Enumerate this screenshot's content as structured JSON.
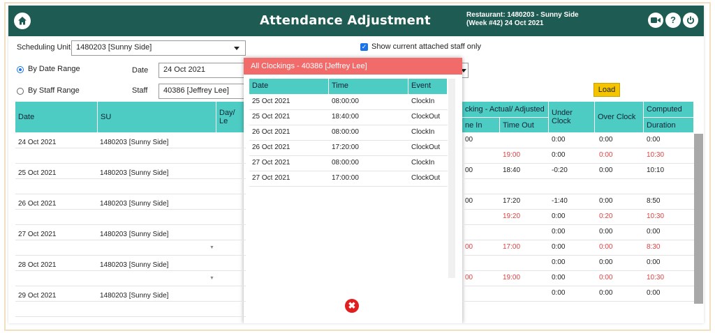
{
  "header": {
    "title": "Attendance Adjustment",
    "restaurant_line1": "Restaurant: 1480203  -  Sunny Side",
    "restaurant_line2": "(Week #42)  24 Oct 2021",
    "icons": [
      "home-icon",
      "video-icon",
      "help-icon",
      "power-icon"
    ],
    "help_glyph": "?",
    "accent": "#1e5b52"
  },
  "filters": {
    "scheduling_unit_label": "Scheduling Unit",
    "scheduling_unit_value": "1480203 [Sunny Side]",
    "show_current_label": "Show current attached staff only",
    "by_date_range_label": "By Date Range",
    "by_staff_range_label": "By Staff Range",
    "date_label": "Date",
    "date_value": "24 Oct 2021",
    "staff_label": "Staff",
    "staff_value": "40386 [Jeffrey Lee]",
    "load_label": "Load"
  },
  "grid": {
    "headers": {
      "date": "Date",
      "su": "SU",
      "day": "Day/ Le",
      "clocking": "cking - Actual/ Adjusted",
      "time_in": "ne In",
      "time_out": "Time Out",
      "under_clock": "Under Clock",
      "over_clock": "Over Clock",
      "computed": "Computed",
      "duration": "Duration"
    },
    "rows": [
      {
        "date": "24 Oct 2021",
        "su": "1480203 [Sunny Side]"
      },
      {
        "date": "25 Oct 2021",
        "su": "1480203 [Sunny Side]"
      },
      {
        "date": "26 Oct 2021",
        "su": "1480203 [Sunny Side]"
      },
      {
        "date": "27 Oct 2021",
        "su": "1480203 [Sunny Side]"
      },
      {
        "date": "28 Oct 2021",
        "su": "1480203 [Sunny Side]"
      },
      {
        "date": "29 Oct 2021",
        "su": "1480203 [Sunny Side]"
      }
    ],
    "right_rows": [
      {
        "in": "00",
        "out": "",
        "under": "0:00",
        "over": "0:00",
        "dur": "0:00",
        "red": false
      },
      {
        "in": "",
        "out": "19:00",
        "under": "0:00",
        "over": "0:00",
        "dur": "10:30",
        "red": true
      },
      {
        "in": "00",
        "out": "18:40",
        "under": "-0:20",
        "over": "0:00",
        "dur": "10:10",
        "red": false
      },
      {
        "in": "",
        "out": "",
        "under": "",
        "over": "",
        "dur": "",
        "red": false
      },
      {
        "in": "00",
        "out": "17:20",
        "under": "-1:40",
        "over": "0:00",
        "dur": "8:50",
        "red": false
      },
      {
        "in": "",
        "out": "19:20",
        "under": "0:00",
        "over": "0:20",
        "dur": "10:30",
        "red": true
      },
      {
        "in": "",
        "out": "",
        "under": "0:00",
        "over": "0:00",
        "dur": "0:00",
        "red": false
      },
      {
        "in": "00",
        "out": "17:00",
        "under": "0:00",
        "over": "0:00",
        "dur": "8:30",
        "red": true
      },
      {
        "in": "",
        "out": "",
        "under": "0:00",
        "over": "0:00",
        "dur": "0:00",
        "red": false
      },
      {
        "in": "00",
        "out": "19:00",
        "under": "0:00",
        "over": "0:00",
        "dur": "10:30",
        "red": true
      },
      {
        "in": "",
        "out": "",
        "under": "0:00",
        "over": "0:00",
        "dur": "0:00",
        "red": false
      }
    ]
  },
  "popup": {
    "title": "All Clockings - 40386 [Jeffrey Lee]",
    "headers": {
      "date": "Date",
      "time": "Time",
      "event": "Event"
    },
    "rows": [
      {
        "date": "25 Oct 2021",
        "time": "08:00:00",
        "event": "ClockIn"
      },
      {
        "date": "25 Oct 2021",
        "time": "18:40:00",
        "event": "ClockOut"
      },
      {
        "date": "26 Oct 2021",
        "time": "08:00:00",
        "event": "ClockIn"
      },
      {
        "date": "26 Oct 2021",
        "time": "17:20:00",
        "event": "ClockOut"
      },
      {
        "date": "27 Oct 2021",
        "time": "08:00:00",
        "event": "ClockIn"
      },
      {
        "date": "27 Oct 2021",
        "time": "17:00:00",
        "event": "ClockOut"
      }
    ],
    "close_glyph": "✖",
    "title_color": "#f26b6b"
  }
}
